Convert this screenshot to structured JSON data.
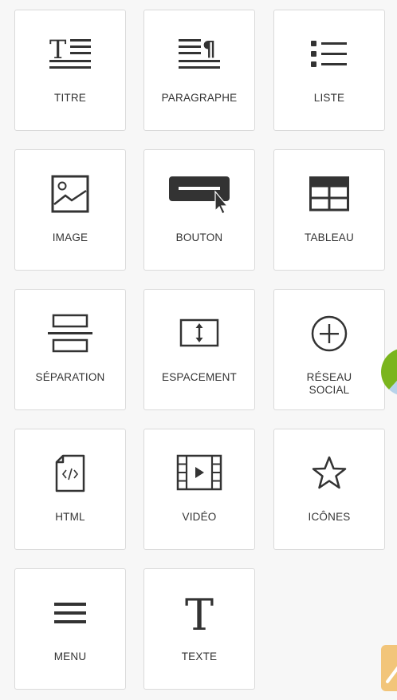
{
  "blocks": [
    {
      "id": "titre",
      "label": "TITRE",
      "icon": "heading-icon"
    },
    {
      "id": "paragraphe",
      "label": "PARAGRAPHE",
      "icon": "paragraph-icon"
    },
    {
      "id": "liste",
      "label": "LISTE",
      "icon": "list-icon"
    },
    {
      "id": "image",
      "label": "IMAGE",
      "icon": "image-icon"
    },
    {
      "id": "bouton",
      "label": "BOUTON",
      "icon": "button-icon"
    },
    {
      "id": "tableau",
      "label": "TABLEAU",
      "icon": "table-icon"
    },
    {
      "id": "separation",
      "label": "SÉPARATION",
      "icon": "separator-icon"
    },
    {
      "id": "espacement",
      "label": "ESPACEMENT",
      "icon": "spacing-icon"
    },
    {
      "id": "reseau-social",
      "label": "RÉSEAU\nSOCIAL",
      "icon": "plus-circle-icon"
    },
    {
      "id": "html",
      "label": "HTML",
      "icon": "html-file-icon"
    },
    {
      "id": "video",
      "label": "VIDÉO",
      "icon": "video-icon"
    },
    {
      "id": "icones",
      "label": "ICÔNES",
      "icon": "star-icon"
    },
    {
      "id": "menu",
      "label": "MENU",
      "icon": "menu-icon"
    },
    {
      "id": "texte",
      "label": "TEXTE",
      "icon": "text-icon"
    }
  ],
  "colors": {
    "icon": "#333333",
    "tile_border": "#dadada",
    "side_chart_green": "#7ab51d",
    "side_chart_blue": "#b7d3ea",
    "side_button": "#f2c57a"
  }
}
